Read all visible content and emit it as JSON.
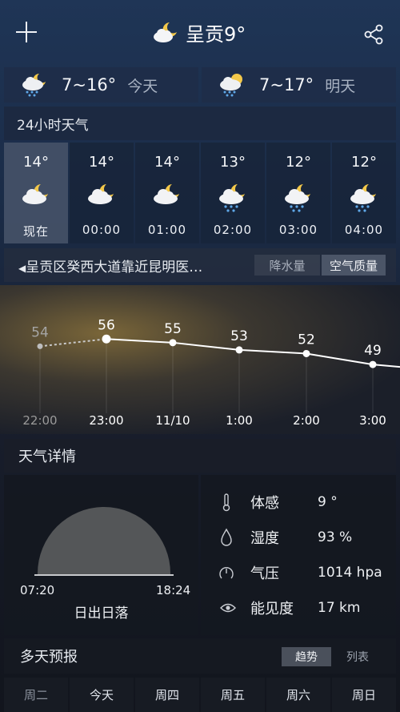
{
  "header": {
    "title": "呈贡9°",
    "add_icon": "plus-icon",
    "share_icon": "share-icon",
    "weather_icon": "moon-cloud-icon"
  },
  "days": [
    {
      "range": "7~16°",
      "name": "今天",
      "icon": "cloud-rain-moon-icon"
    },
    {
      "range": "7~17°",
      "name": "明天",
      "icon": "sun-cloud-rain-icon"
    }
  ],
  "hourly": {
    "title": "24小时天气",
    "items": [
      {
        "temp": "14°",
        "label": "现在",
        "icon": "moon-cloud-icon"
      },
      {
        "temp": "14°",
        "label": "00:00",
        "icon": "moon-cloud-icon"
      },
      {
        "temp": "14°",
        "label": "01:00",
        "icon": "moon-cloud-icon"
      },
      {
        "temp": "13°",
        "label": "02:00",
        "icon": "moon-cloud-rain-icon"
      },
      {
        "temp": "12°",
        "label": "03:00",
        "icon": "moon-cloud-rain-icon"
      },
      {
        "temp": "12°",
        "label": "04:00",
        "icon": "moon-cloud-rain-icon"
      }
    ]
  },
  "location": {
    "text": "呈贡区癸西大道靠近昆明医…",
    "tab_rain": "降水量",
    "tab_air": "空气质量"
  },
  "chart_data": {
    "type": "line",
    "categories": [
      "22:00",
      "23:00",
      "11/10",
      "1:00",
      "2:00",
      "3:00"
    ],
    "values": [
      54,
      56,
      55,
      53,
      52,
      49
    ],
    "ylim": [
      0,
      100
    ]
  },
  "details": {
    "title": "天气详情",
    "sunrise": "07:20",
    "sunset": "18:24",
    "sun_label": "日出日落",
    "rows": [
      {
        "label": "体感",
        "value": "9 °",
        "icon": "thermometer-icon"
      },
      {
        "label": "湿度",
        "value": "93 %",
        "icon": "drop-icon"
      },
      {
        "label": "气压",
        "value": "1014 hpa",
        "icon": "gauge-icon"
      },
      {
        "label": "能见度",
        "value": "17 km",
        "icon": "eye-icon"
      }
    ]
  },
  "forecast": {
    "title": "多天预报",
    "tab_trend": "趋势",
    "tab_list": "列表",
    "days": [
      "周二",
      "今天",
      "周四",
      "周五",
      "周六",
      "周日"
    ]
  }
}
